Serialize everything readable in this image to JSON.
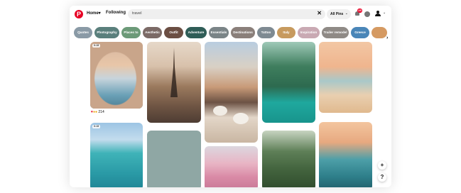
{
  "header": {
    "logo_letter": "P",
    "home_label": "Home",
    "home_chevron": "▾",
    "following_label": "Following",
    "search_value": "travel",
    "clear_glyph": "✕",
    "filter_label": "All Pins",
    "filter_chevron": "⌄",
    "notifications_badge": "25",
    "menu_chevron": "⌄"
  },
  "chips": [
    {
      "label": "Quotes",
      "color": "#8a9aa6"
    },
    {
      "label": "Photography",
      "color": "#5a7f7c"
    },
    {
      "label": "Places to",
      "color": "#6c9a78"
    },
    {
      "label": "Aesthetic",
      "color": "#7b6a66"
    },
    {
      "label": "Outfit",
      "color": "#6b4e43"
    },
    {
      "label": "Adventure",
      "color": "#2f5d57"
    },
    {
      "label": "Essentials",
      "color": "#7a8487"
    },
    {
      "label": "Destinations",
      "color": "#8a7f7a"
    },
    {
      "label": "Tattoo",
      "color": "#7e8a92"
    },
    {
      "label": "Italy",
      "color": "#c79a5e"
    },
    {
      "label": "Inspiration",
      "color": "#c9a9b3"
    },
    {
      "label": "Trailer remodel",
      "color": "#8f8a86"
    },
    {
      "label": "Greece",
      "color": "#4a86b8"
    },
    {
      "label": "",
      "color": "#d59a62"
    }
  ],
  "chips_next_glyph": "›",
  "pins": [
    {
      "name": "pin-infinity-pool-arch",
      "tag": "0:15"
    },
    {
      "name": "pin-eiffel-tower-street",
      "tag": ""
    },
    {
      "name": "pin-venice-dining",
      "tag": ""
    },
    {
      "name": "pin-emerald-canyon-river",
      "tag": ""
    },
    {
      "name": "pin-tropical-beach-sunset",
      "tag": ""
    },
    {
      "name": "pin-maldives-villas",
      "tag": "0:15"
    },
    {
      "name": "pin-sage-placeholder",
      "tag": ""
    },
    {
      "name": "pin-cherry-blossom-cathedral",
      "tag": ""
    },
    {
      "name": "pin-jungle-ruins",
      "tag": ""
    },
    {
      "name": "pin-island-lagoon",
      "tag": ""
    }
  ],
  "reactions": {
    "count": "214"
  },
  "fab": {
    "add_label": "+",
    "help_label": "?"
  }
}
